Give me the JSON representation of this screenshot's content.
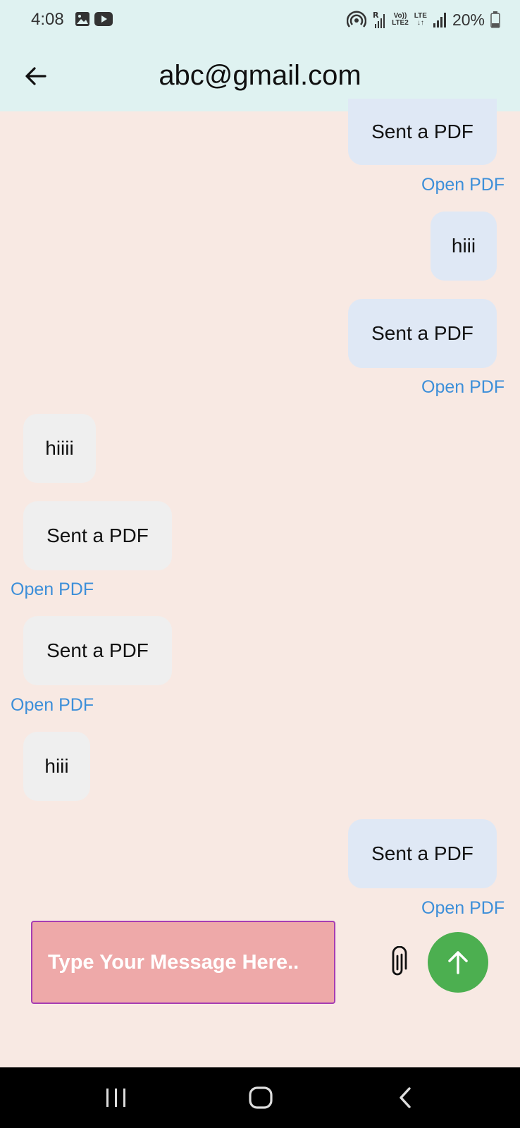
{
  "status_bar": {
    "time": "4:08",
    "battery": "20%",
    "icons": [
      "gallery-icon",
      "youtube-icon",
      "hotspot-icon",
      "roaming-signal-icon",
      "volte-icon",
      "lte-icon",
      "signal-icon",
      "battery-icon"
    ],
    "volte_label": "Vo))",
    "lte2_label": "LTE2",
    "lte_label": "LTE"
  },
  "app_bar": {
    "title": "abc@gmail.com",
    "back_icon": "arrow-back-icon"
  },
  "messages": [
    {
      "sender": "me",
      "text": "Sent a PDF",
      "link": "Open PDF"
    },
    {
      "sender": "me",
      "text": "hiii"
    },
    {
      "sender": "me",
      "text": "Sent a PDF",
      "link": "Open PDF"
    },
    {
      "sender": "other",
      "text": "hiiii"
    },
    {
      "sender": "other",
      "text": "Sent a PDF",
      "link": "Open PDF"
    },
    {
      "sender": "other",
      "text": "Sent a PDF",
      "link": "Open PDF"
    },
    {
      "sender": "other",
      "text": "hiii"
    },
    {
      "sender": "me",
      "text": "Sent a PDF",
      "link": "Open PDF"
    }
  ],
  "composer": {
    "placeholder": "Type Your Message Here..",
    "attach_icon": "paperclip-icon",
    "send_icon": "arrow-up-icon"
  },
  "colors": {
    "app_bar_bg": "#dff2f1",
    "chat_bg": "#f8e9e3",
    "sent_bubble": "#dfe8f5",
    "received_bubble": "#efefef",
    "link": "#3d8fd9",
    "input_bg": "#eea9a9",
    "input_border": "#a63db3",
    "send_button": "#4caf50"
  },
  "nav_bar": {
    "items": [
      "recent-apps-icon",
      "home-icon",
      "back-icon"
    ]
  }
}
